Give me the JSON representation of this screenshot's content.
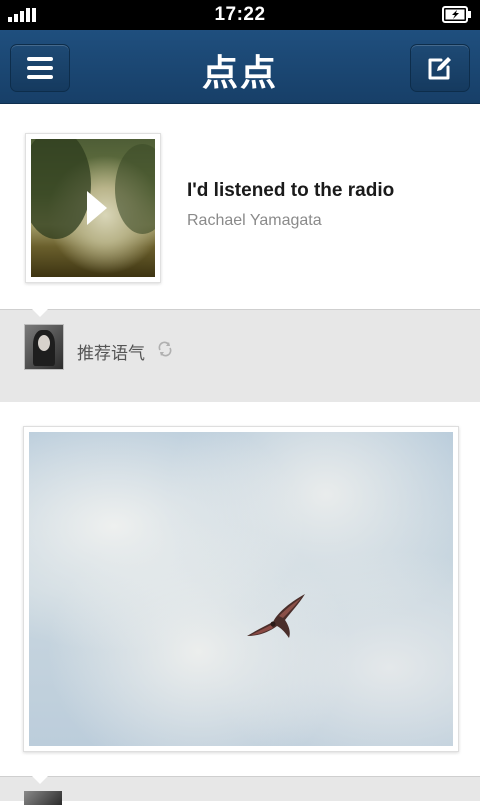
{
  "status_bar": {
    "time": "17:22",
    "signal_icon": "signal-bars-icon",
    "battery_icon": "battery-charging-icon"
  },
  "header": {
    "app_title": "点点",
    "menu_icon": "menu-icon",
    "compose_icon": "compose-icon",
    "background_color": "#1b4673"
  },
  "feed": {
    "music_post": {
      "song_title": "I'd listened to the radio",
      "artist": "Rachael Yamagata",
      "play_icon": "play-icon"
    },
    "music_post_author": {
      "name": "推荐语气",
      "reblog_icon": "reblog-icon"
    },
    "photo_post": {
      "image_subject": "bird-in-cloudy-sky"
    }
  }
}
